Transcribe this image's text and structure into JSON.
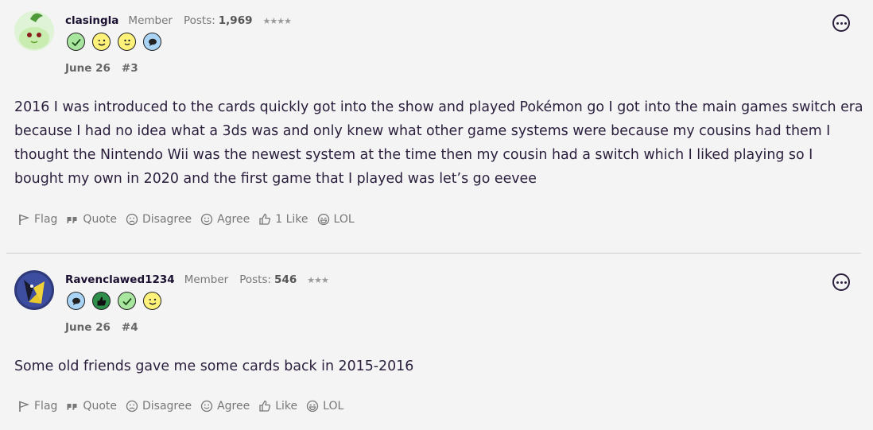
{
  "posts": [
    {
      "username": "clasingla",
      "role": "Member",
      "posts_label": "Posts:",
      "posts_count": "1,969",
      "stars": "★★★★",
      "badges": [
        "check-badge-icon",
        "wink-badge-icon",
        "smile-badge-icon",
        "chat-badge-icon"
      ],
      "date": "June 26",
      "number": "#3",
      "body": "2016 I was introduced to the cards quickly got into the show and played Pokémon go I got into the main games switch era because I had no idea what a 3ds was and only knew what other game systems were because my cousins had them I thought the Nintendo Wii was the newest system at the time then my cousin had a switch which I liked playing so I bought my own in 2020 and the first game that I played was let’s go eevee",
      "actions": {
        "flag": "Flag",
        "quote": "Quote",
        "disagree": "Disagree",
        "agree": "Agree",
        "like": "1 Like",
        "lol": "LOL"
      }
    },
    {
      "username": "Ravenclawed1234",
      "role": "Member",
      "posts_label": "Posts:",
      "posts_count": "546",
      "stars": "★★★",
      "badges": [
        "chat-badge-icon",
        "thumbs-up-badge-icon",
        "check-badge-icon",
        "wink-badge-icon"
      ],
      "date": "June 26",
      "number": "#4",
      "body": "Some old friends gave me some cards back in 2015-2016",
      "actions": {
        "flag": "Flag",
        "quote": "Quote",
        "disagree": "Disagree",
        "agree": "Agree",
        "like": "Like",
        "lol": "LOL"
      }
    }
  ],
  "colors": {
    "background": "#f4f4f4",
    "text": "#2a1e3c",
    "muted": "#777777"
  }
}
